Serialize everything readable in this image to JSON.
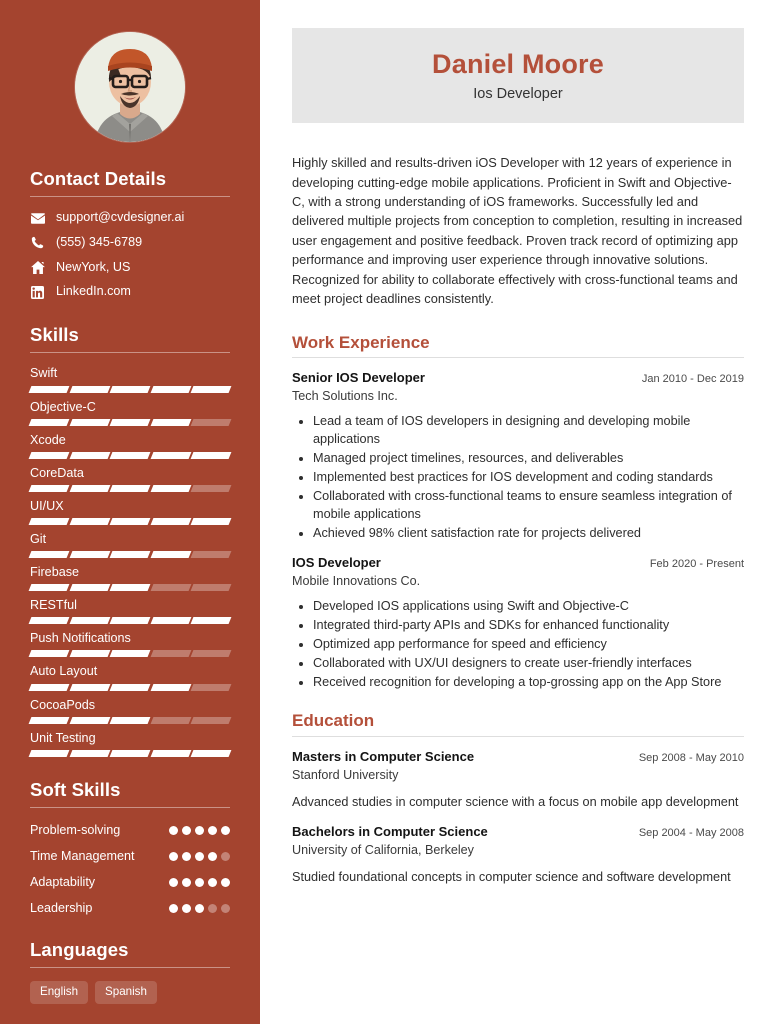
{
  "theme": {
    "sidebar_bg": "#A4442F",
    "accent": "#B4503A",
    "name_card_bg": "#e6e6e6",
    "body_text": "#2e2e2e"
  },
  "sidebar": {
    "photo_alt": "profile-photo",
    "contact": {
      "heading": "Contact Details",
      "items": [
        {
          "icon": "envelope-icon",
          "label": "support@cvdesigner.ai"
        },
        {
          "icon": "phone-icon",
          "label": "(555) 345-6789"
        },
        {
          "icon": "home-icon",
          "label": "NewYork, US"
        },
        {
          "icon": "linkedin-icon",
          "label": "LinkedIn.com"
        }
      ]
    },
    "skills": {
      "heading": "Skills",
      "max": 5,
      "items": [
        {
          "label": "Swift",
          "level": 5
        },
        {
          "label": "Objective-C",
          "level": 4
        },
        {
          "label": "Xcode",
          "level": 5
        },
        {
          "label": "CoreData",
          "level": 4
        },
        {
          "label": "UI/UX",
          "level": 5
        },
        {
          "label": "Git",
          "level": 4
        },
        {
          "label": "Firebase",
          "level": 3
        },
        {
          "label": "RESTful",
          "level": 5
        },
        {
          "label": "Push Notifications",
          "level": 3
        },
        {
          "label": "Auto Layout",
          "level": 4
        },
        {
          "label": "CocoaPods",
          "level": 3
        },
        {
          "label": "Unit Testing",
          "level": 5
        }
      ]
    },
    "soft_skills": {
      "heading": "Soft Skills",
      "max": 5,
      "items": [
        {
          "label": "Problem-solving",
          "level": 5
        },
        {
          "label": "Time Management",
          "level": 4
        },
        {
          "label": "Adaptability",
          "level": 5
        },
        {
          "label": "Leadership",
          "level": 3
        }
      ]
    },
    "languages": {
      "heading": "Languages",
      "items": [
        "English",
        "Spanish"
      ]
    }
  },
  "main": {
    "name": "Daniel Moore",
    "title": "Ios Developer",
    "summary": "Highly skilled and results-driven iOS Developer with 12 years of experience in developing cutting-edge mobile applications. Proficient in Swift and Objective-C, with a strong understanding of iOS frameworks. Successfully led and delivered multiple projects from conception to completion, resulting in increased user engagement and positive feedback. Proven track record of optimizing app performance and improving user experience through innovative solutions. Recognized for ability to collaborate effectively with cross-functional teams and meet project deadlines consistently.",
    "work": {
      "heading": "Work Experience",
      "entries": [
        {
          "role": "Senior IOS Developer",
          "org": "Tech Solutions Inc.",
          "dates": "Jan 2010 - Dec 2019",
          "bullets": [
            "Lead a team of IOS developers in designing and developing mobile applications",
            "Managed project timelines, resources, and deliverables",
            "Implemented best practices for IOS development and coding standards",
            "Collaborated with cross-functional teams to ensure seamless integration of mobile applications",
            "Achieved 98% client satisfaction rate for projects delivered"
          ]
        },
        {
          "role": "IOS Developer",
          "org": "Mobile Innovations Co.",
          "dates": "Feb 2020 - Present",
          "bullets": [
            "Developed IOS applications using Swift and Objective-C",
            "Integrated third-party APIs and SDKs for enhanced functionality",
            "Optimized app performance for speed and efficiency",
            "Collaborated with UX/UI designers to create user-friendly interfaces",
            "Received recognition for developing a top-grossing app on the App Store"
          ]
        }
      ]
    },
    "education": {
      "heading": "Education",
      "entries": [
        {
          "degree": "Masters in Computer Science",
          "school": "Stanford University",
          "dates": "Sep 2008 - May 2010",
          "description": "Advanced studies in computer science with a focus on mobile app development"
        },
        {
          "degree": "Bachelors in Computer Science",
          "school": "University of California, Berkeley",
          "dates": "Sep 2004 - May 2008",
          "description": "Studied foundational concepts in computer science and software development"
        }
      ]
    }
  }
}
